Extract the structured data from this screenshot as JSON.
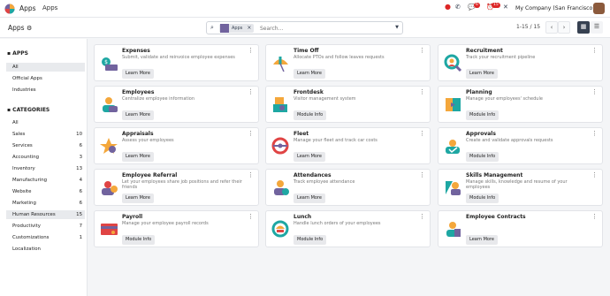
{
  "topbar": {
    "title": "Apps",
    "menu": "Apps",
    "badges": [
      "6",
      "15"
    ],
    "company": "My Company (San Francisco)"
  },
  "control": {
    "breadcrumb": "Apps",
    "facet": "Apps",
    "search_placeholder": "Search...",
    "pager": "1-15 / 15"
  },
  "sidebar": {
    "apps_heading": "APPS",
    "apps": [
      {
        "label": "All",
        "active": true
      },
      {
        "label": "Official Apps"
      },
      {
        "label": "Industries"
      }
    ],
    "cat_heading": "CATEGORIES",
    "categories": [
      {
        "label": "All",
        "count": ""
      },
      {
        "label": "Sales",
        "count": "10"
      },
      {
        "label": "Services",
        "count": "6"
      },
      {
        "label": "Accounting",
        "count": "3"
      },
      {
        "label": "Inventory",
        "count": "13"
      },
      {
        "label": "Manufacturing",
        "count": "4"
      },
      {
        "label": "Website",
        "count": "6"
      },
      {
        "label": "Marketing",
        "count": "6"
      },
      {
        "label": "Human Resources",
        "count": "15",
        "active": true
      },
      {
        "label": "Productivity",
        "count": "7"
      },
      {
        "label": "Customizations",
        "count": "1"
      },
      {
        "label": "Localization",
        "count": ""
      }
    ]
  },
  "apps": [
    {
      "name": "Expenses",
      "desc": "Submit, validate and reinvoice employee expenses",
      "button": "Learn More",
      "icon": "expenses-icon"
    },
    {
      "name": "Time Off",
      "desc": "Allocate PTOs and follow leaves requests",
      "button": "Learn More",
      "icon": "time-off-icon"
    },
    {
      "name": "Recruitment",
      "desc": "Track your recruitment pipeline",
      "button": "Learn More",
      "icon": "recruitment-icon"
    },
    {
      "name": "Employees",
      "desc": "Centralize employee information",
      "button": "Learn More",
      "icon": "employees-icon"
    },
    {
      "name": "Frontdesk",
      "desc": "Visitor management system",
      "button": "Module Info",
      "icon": "frontdesk-icon"
    },
    {
      "name": "Planning",
      "desc": "Manage your employees' schedule",
      "button": "Module Info",
      "icon": "planning-icon"
    },
    {
      "name": "Appraisals",
      "desc": "Assess your employees",
      "button": "Learn More",
      "icon": "appraisals-icon"
    },
    {
      "name": "Fleet",
      "desc": "Manage your fleet and track car costs",
      "button": "Learn More",
      "icon": "fleet-icon"
    },
    {
      "name": "Approvals",
      "desc": "Create and validate approvals requests",
      "button": "Module Info",
      "icon": "approvals-icon"
    },
    {
      "name": "Employee Referral",
      "desc": "Let your employees share job positions and refer their friends",
      "button": "Learn More",
      "icon": "referral-icon"
    },
    {
      "name": "Attendances",
      "desc": "Track employee attendance",
      "button": "Learn More",
      "icon": "attendances-icon"
    },
    {
      "name": "Skills Management",
      "desc": "Manage skills, knowledge and resume of your employees",
      "button": "Module Info",
      "icon": "skills-icon"
    },
    {
      "name": "Payroll",
      "desc": "Manage your employee payroll records",
      "button": "Module Info",
      "icon": "payroll-icon"
    },
    {
      "name": "Lunch",
      "desc": "Handle lunch orders of your employees",
      "button": "Module Info",
      "icon": "lunch-icon"
    },
    {
      "name": "Employee Contracts",
      "desc": "",
      "button": "Learn More",
      "icon": "contracts-icon"
    }
  ],
  "colors": {
    "accent": "#71639e",
    "teal": "#1ea7a3",
    "orange": "#f4a73b",
    "red": "#e04444"
  }
}
